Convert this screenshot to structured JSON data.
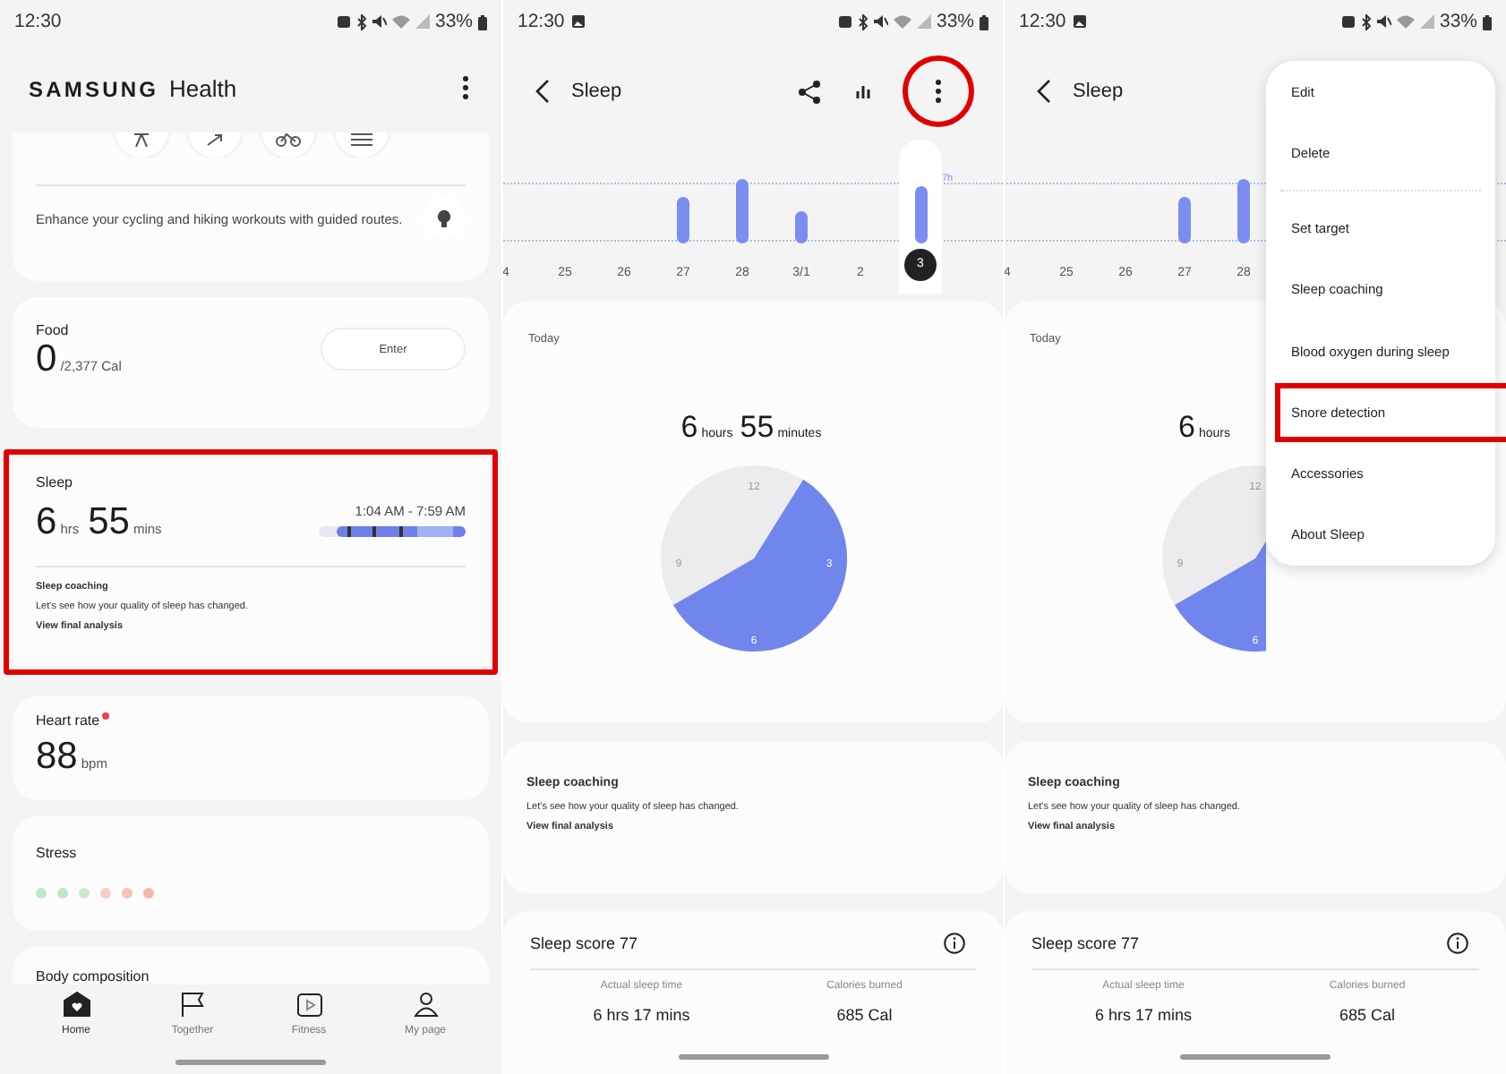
{
  "home": {
    "status_bar": {
      "time": "12:30",
      "battery": "33%"
    },
    "brand": {
      "word1": "SAMSUNG",
      "word2": "Health"
    },
    "routes_text": "Enhance your cycling and hiking workouts with guided routes.",
    "food": {
      "title": "Food",
      "value": "0",
      "target": "/2,377 Cal",
      "button": "Enter"
    },
    "sleep": {
      "title": "Sleep",
      "hours": "6",
      "hours_unit": "hrs",
      "minutes": "55",
      "minutes_unit": "mins",
      "range": "1:04 AM - 7:59 AM",
      "coaching_title": "Sleep coaching",
      "coaching_text": "Let's see how your quality of sleep has changed.",
      "coaching_link": "View final analysis",
      "highlighted": true
    },
    "heart_rate": {
      "title": "Heart rate",
      "value": "88",
      "unit": "bpm"
    },
    "stress": {
      "title": "Stress",
      "dots": [
        {
          "color": "#bfe8c8"
        },
        {
          "color": "#bfe8c8"
        },
        {
          "color": "#c8ebcf"
        },
        {
          "color": "#f7cfc0"
        },
        {
          "color": "#f5c4b4"
        },
        {
          "color": "#f3b9aa"
        }
      ]
    },
    "body_composition": {
      "title": "Body composition"
    },
    "nav": [
      {
        "label": "Home",
        "selected": true
      },
      {
        "label": "Together",
        "selected": false
      },
      {
        "label": "Fitness",
        "selected": false
      },
      {
        "label": "My page",
        "selected": false
      }
    ]
  },
  "sleep_views": [
    {
      "status_bar": {
        "time": "12:30",
        "battery": "33%"
      },
      "title": "Sleep",
      "more_highlighted": true,
      "days": [
        {
          "label": "4",
          "selected": false
        },
        {
          "label": "25",
          "selected": false
        },
        {
          "label": "26",
          "selected": false
        },
        {
          "label": "27",
          "selected": false
        },
        {
          "label": "28",
          "selected": false
        },
        {
          "label": "3/1",
          "selected": false
        },
        {
          "label": "2",
          "selected": false
        },
        {
          "label": "3",
          "selected": true
        }
      ],
      "goal_label": "7h",
      "today": "Today",
      "hours": "6",
      "hours_unit": "hours",
      "minutes": "55",
      "minutes_unit": "minutes",
      "clock": [
        "12",
        "3",
        "6",
        "9"
      ],
      "coaching": {
        "title": "Sleep coaching",
        "text": "Let's see how your quality of sleep has changed.",
        "link": "View final analysis"
      },
      "score": "Sleep score 77",
      "stats": [
        {
          "label": "Actual sleep time",
          "value": "6 hrs 17 mins"
        },
        {
          "label": "Calories burned",
          "value": "685 Cal"
        }
      ]
    },
    {
      "status_bar": {
        "time": "12:30",
        "battery": "33%"
      },
      "title": "Sleep",
      "days": [
        {
          "label": "4",
          "selected": false
        },
        {
          "label": "25",
          "selected": false
        },
        {
          "label": "26",
          "selected": false
        },
        {
          "label": "27",
          "selected": false
        },
        {
          "label": "28",
          "selected": false
        }
      ],
      "today": "Today",
      "hours": "6",
      "hours_unit": "hours",
      "clock": [
        "12",
        "6",
        "9"
      ],
      "coaching": {
        "title": "Sleep coaching",
        "text": "Let's see how your quality of sleep has changed.",
        "link": "View final analysis"
      },
      "score": "Sleep score 77",
      "stats": [
        {
          "label": "Actual sleep time",
          "value": "6 hrs 17 mins"
        },
        {
          "label": "Calories burned",
          "value": "685 Cal"
        }
      ],
      "menu": [
        [
          {
            "label": "Edit",
            "highlighted": false
          },
          {
            "label": "Delete",
            "highlighted": false
          }
        ],
        [
          {
            "label": "Set target",
            "highlighted": false
          },
          {
            "label": "Sleep coaching",
            "highlighted": false
          },
          {
            "label": "Blood oxygen during sleep",
            "highlighted": false
          },
          {
            "label": "Snore detection",
            "highlighted": true
          },
          {
            "label": "Accessories",
            "highlighted": false
          },
          {
            "label": "About Sleep",
            "highlighted": false
          }
        ]
      ]
    }
  ]
}
